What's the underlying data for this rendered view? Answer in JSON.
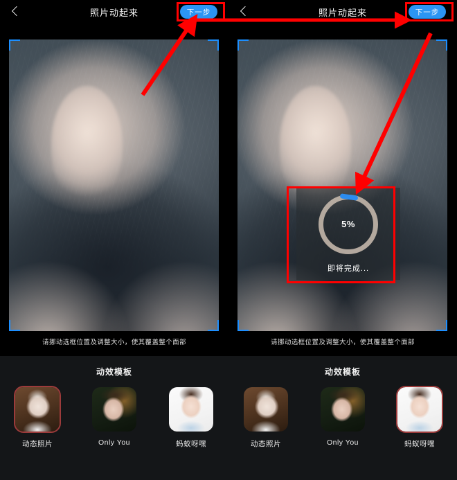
{
  "app": {
    "header_title": "照片动起来",
    "next_label": "下一步",
    "back_icon": "chevron-left-icon",
    "hint": "请挪动选框位置及调整大小，使其覆盖整个面部"
  },
  "templates": {
    "section_title": "动效模板",
    "items": [
      {
        "label": "动态照片",
        "thumb": "elderly-woman-smiling-thumb"
      },
      {
        "label": "Only You",
        "thumb": "short-hair-woman-thumb"
      },
      {
        "label": "蚂蚁呀嘿",
        "thumb": "woman-blue-shirt-thumb"
      }
    ]
  },
  "panels": {
    "left": {
      "selected_template_index": 0
    },
    "right": {
      "selected_template_index": 2,
      "progress": {
        "percent_label": "5%",
        "percent_value": 5,
        "status_label": "即将完成...",
        "ring_color": "#cdbeb2",
        "fill_color": "#2b8cf0"
      }
    }
  },
  "annotations": {
    "color": "#ff0000",
    "left_arrow_target": "next-step-button",
    "right_arrow_target": "progress-dialog"
  },
  "colors": {
    "accent_blue": "#2b95f4",
    "frame_blue": "#1d8fff",
    "selected_border": "#9c3b3b",
    "panel_bg": "#141618",
    "page_bg": "#000000"
  }
}
